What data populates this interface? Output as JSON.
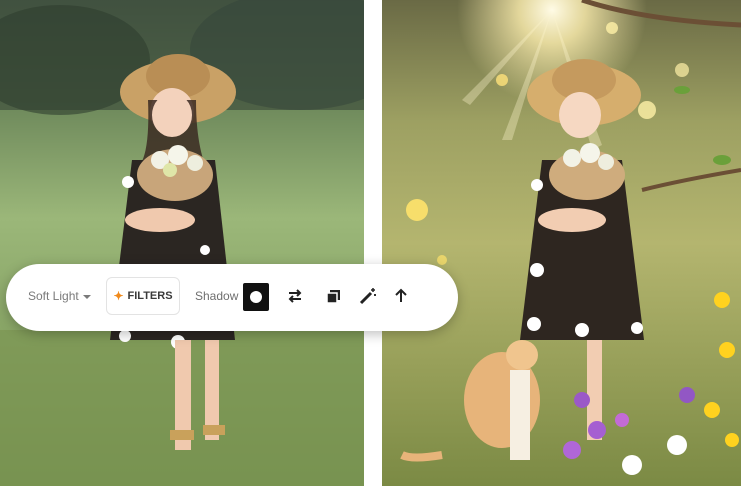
{
  "toolbar": {
    "blend_mode": "Soft Light",
    "filters_label": "FILTERS",
    "shadow_label": "Shadow"
  },
  "icons": {
    "sparkle": "sparkle-icon",
    "shadow_toggle": "circle-toggle-icon",
    "swap": "swap-arrows-icon",
    "duplicate": "duplicate-layers-icon",
    "magic": "magic-wand-icon",
    "up": "arrow-up-icon"
  },
  "colors": {
    "accent": "#f08a1c",
    "active_button": "#111111",
    "toolbar_bg": "#ffffff"
  }
}
